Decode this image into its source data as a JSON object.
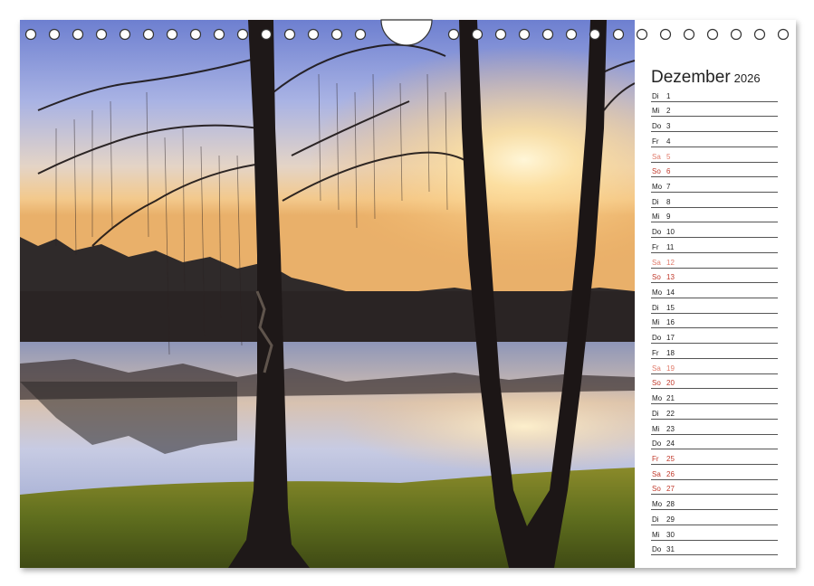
{
  "calendar": {
    "month": "Dezember",
    "year": "2026",
    "days": [
      {
        "wd": "Di",
        "d": "1",
        "type": "weekday"
      },
      {
        "wd": "Mi",
        "d": "2",
        "type": "weekday"
      },
      {
        "wd": "Do",
        "d": "3",
        "type": "weekday"
      },
      {
        "wd": "Fr",
        "d": "4",
        "type": "weekday"
      },
      {
        "wd": "Sa",
        "d": "5",
        "type": "sat"
      },
      {
        "wd": "So",
        "d": "6",
        "type": "sun"
      },
      {
        "wd": "Mo",
        "d": "7",
        "type": "weekday"
      },
      {
        "wd": "Di",
        "d": "8",
        "type": "weekday"
      },
      {
        "wd": "Mi",
        "d": "9",
        "type": "weekday"
      },
      {
        "wd": "Do",
        "d": "10",
        "type": "weekday"
      },
      {
        "wd": "Fr",
        "d": "11",
        "type": "weekday"
      },
      {
        "wd": "Sa",
        "d": "12",
        "type": "sat"
      },
      {
        "wd": "So",
        "d": "13",
        "type": "sun"
      },
      {
        "wd": "Mo",
        "d": "14",
        "type": "weekday"
      },
      {
        "wd": "Di",
        "d": "15",
        "type": "weekday"
      },
      {
        "wd": "Mi",
        "d": "16",
        "type": "weekday"
      },
      {
        "wd": "Do",
        "d": "17",
        "type": "weekday"
      },
      {
        "wd": "Fr",
        "d": "18",
        "type": "weekday"
      },
      {
        "wd": "Sa",
        "d": "19",
        "type": "sat"
      },
      {
        "wd": "So",
        "d": "20",
        "type": "sun"
      },
      {
        "wd": "Mo",
        "d": "21",
        "type": "weekday"
      },
      {
        "wd": "Di",
        "d": "22",
        "type": "weekday"
      },
      {
        "wd": "Mi",
        "d": "23",
        "type": "weekday"
      },
      {
        "wd": "Do",
        "d": "24",
        "type": "weekday"
      },
      {
        "wd": "Fr",
        "d": "25",
        "type": "hol"
      },
      {
        "wd": "Sa",
        "d": "26",
        "type": "hol"
      },
      {
        "wd": "So",
        "d": "27",
        "type": "sun"
      },
      {
        "wd": "Mo",
        "d": "28",
        "type": "weekday"
      },
      {
        "wd": "Di",
        "d": "29",
        "type": "weekday"
      },
      {
        "wd": "Mi",
        "d": "30",
        "type": "weekday"
      },
      {
        "wd": "Do",
        "d": "31",
        "type": "weekday"
      }
    ]
  },
  "colors": {
    "saturday": "#e07a6a",
    "sunday": "#c0392b",
    "text": "#222222"
  }
}
